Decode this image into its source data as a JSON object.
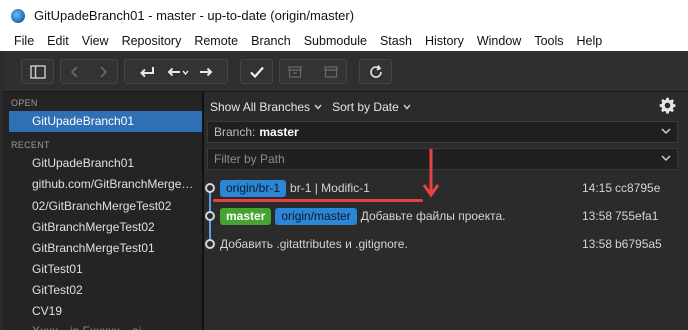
{
  "window": {
    "title": "GitUpadeBranch01 - master - up-to-date (origin/master)"
  },
  "menu": [
    "File",
    "Edit",
    "View",
    "Repository",
    "Remote",
    "Branch",
    "Submodule",
    "Stash",
    "History",
    "Window",
    "Tools",
    "Help"
  ],
  "toolbar": {
    "icons": [
      "sidebar-toggle-icon",
      "back-icon",
      "forward-icon",
      "commit-icon",
      "pull-icon",
      "push-icon",
      "checkout-icon",
      "stash-icon",
      "stash-pop-icon",
      "refresh-icon"
    ]
  },
  "sidebar": {
    "open_header": "OPEN",
    "open_repos": [
      "GitUpadeBranch01"
    ],
    "recent_header": "RECENT",
    "recent_repos": [
      "GitUpadeBranch01",
      "github.com/GitBranchMerge…",
      "02/GitBranchMergeTest02",
      "GitBranchMergeTest02",
      "GitBranchMergeTest01",
      "GitTest01",
      "GitTest02",
      "CV19",
      "Xxxx…in Fxxxxx…ai"
    ]
  },
  "filters": {
    "branches": "Show All Branches",
    "sort": "Sort by Date"
  },
  "branch_combo": {
    "label": "Branch:",
    "value": "master"
  },
  "path_filter": {
    "placeholder": "Filter by Path"
  },
  "commits": [
    {
      "badges": [
        {
          "text": "origin/br-1",
          "kind": "remote"
        }
      ],
      "message": "br-1 | Modific-1",
      "time": "14:15",
      "hash": "cc8795e"
    },
    {
      "badges": [
        {
          "text": "master",
          "kind": "local"
        },
        {
          "text": "origin/master",
          "kind": "remote"
        }
      ],
      "message": "Добавьте файлы проекта.",
      "time": "13:58",
      "hash": "755efa1"
    },
    {
      "badges": [],
      "message": "Добавить .gitattributes и .gitignore.",
      "time": "13:58",
      "hash": "b6795a5"
    }
  ],
  "colors": {
    "accent_selected": "#2f6fb3",
    "remote_badge": "#2b86d6",
    "local_badge": "#46a32f",
    "annotation": "#e84343"
  }
}
